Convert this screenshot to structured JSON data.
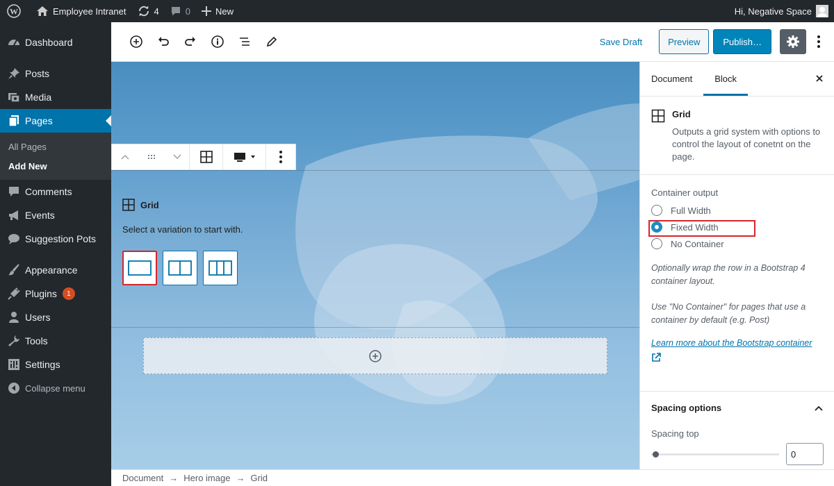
{
  "admin_bar": {
    "site_name": "Employee Intranet",
    "updates_count": "4",
    "comments_count": "0",
    "new_label": "New",
    "greeting": "Hi, Negative Space"
  },
  "sidebar": {
    "items": [
      {
        "label": "Dashboard",
        "icon": "dashboard-icon"
      },
      {
        "label": "Posts",
        "icon": "pin-icon"
      },
      {
        "label": "Media",
        "icon": "media-icon"
      },
      {
        "label": "Pages",
        "icon": "pages-icon"
      },
      {
        "label": "Comments",
        "icon": "comment-icon"
      },
      {
        "label": "Events",
        "icon": "megaphone-icon"
      },
      {
        "label": "Suggestion Pots",
        "icon": "speech-icon"
      },
      {
        "label": "Appearance",
        "icon": "brush-icon"
      },
      {
        "label": "Plugins",
        "icon": "plug-icon",
        "badge": "1"
      },
      {
        "label": "Users",
        "icon": "user-icon"
      },
      {
        "label": "Tools",
        "icon": "wrench-icon"
      },
      {
        "label": "Settings",
        "icon": "settings-icon"
      },
      {
        "label": "Collapse menu",
        "icon": "collapse-icon"
      }
    ],
    "pages_submenu": [
      "All Pages",
      "Add New"
    ]
  },
  "editor_header": {
    "save_draft": "Save Draft",
    "preview": "Preview",
    "publish": "Publish…"
  },
  "canvas": {
    "block_title": "Grid",
    "instruction": "Select a variation to start with.",
    "variations": [
      "one-column",
      "two-columns",
      "three-columns"
    ]
  },
  "panel": {
    "tabs": [
      "Document",
      "Block"
    ],
    "active_tab": "Block",
    "block_name": "Grid",
    "block_description": "Outputs a grid system with options to control the layout of conetnt on the page.",
    "container_label": "Container output",
    "options": [
      "Full Width",
      "Fixed Width",
      "No Container"
    ],
    "selected_option": "Fixed Width",
    "help1": "Optionally wrap the row in a Bootstrap 4 container layout.",
    "help2": "Use \"No Container\" for pages that use a container by default (e.g. Post)",
    "link": "Learn more about the Bootstrap container",
    "spacing_title": "Spacing options",
    "spacing_top_label": "Spacing top",
    "spacing_top_value": "0"
  },
  "breadcrumb": [
    "Document",
    "Hero image",
    "Grid"
  ],
  "colors": {
    "admin_dark": "#23282d",
    "accent": "#0073aa",
    "highlight": "#d4252c"
  }
}
